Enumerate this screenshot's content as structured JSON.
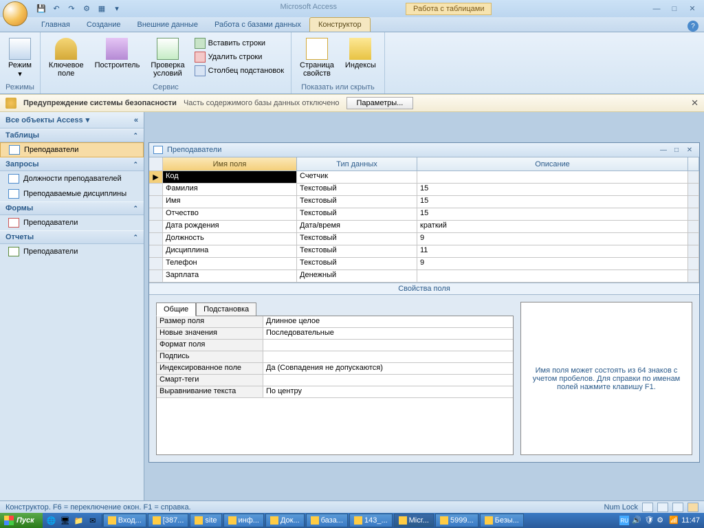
{
  "titlebar": {
    "app_name": "Microsoft Access",
    "contextual": "Работа с таблицами"
  },
  "tabs": {
    "items": [
      "Главная",
      "Создание",
      "Внешние данные",
      "Работа с базами данных",
      "Конструктор"
    ],
    "active": 4
  },
  "ribbon": {
    "groups": {
      "modes": {
        "label": "Режимы",
        "mode": "Режим"
      },
      "service": {
        "label": "Сервис",
        "key": "Ключевое\nполе",
        "builder": "Построитель",
        "test": "Проверка\nусловий",
        "insert_rows": "Вставить строки",
        "delete_rows": "Удалить строки",
        "lookup_col": "Столбец подстановок"
      },
      "show_hide": {
        "label": "Показать или скрыть",
        "prop_page": "Страница\nсвойств",
        "indexes": "Индексы"
      }
    }
  },
  "security": {
    "title": "Предупреждение системы безопасности",
    "text": "Часть содержимого базы данных отключено",
    "button": "Параметры..."
  },
  "nav": {
    "header": "Все объекты Access",
    "categories": [
      {
        "label": "Таблицы",
        "items": [
          "Преподаватели"
        ]
      },
      {
        "label": "Запросы",
        "items": [
          "Должности преподавателей",
          "Преподаваемые дисциплины"
        ]
      },
      {
        "label": "Формы",
        "items": [
          "Преподаватели"
        ]
      },
      {
        "label": "Отчеты",
        "items": [
          "Преподаватели"
        ]
      }
    ]
  },
  "doc": {
    "title": "Преподаватели",
    "columns": {
      "name": "Имя поля",
      "type": "Тип данных",
      "desc": "Описание"
    },
    "rows": [
      {
        "name": "Код",
        "type": "Счетчик",
        "desc": ""
      },
      {
        "name": "Фамилия",
        "type": "Текстовый",
        "desc": "15"
      },
      {
        "name": "Имя",
        "type": "Текстовый",
        "desc": "15"
      },
      {
        "name": "Отчество",
        "type": "Текстовый",
        "desc": "15"
      },
      {
        "name": "Дата рождения",
        "type": "Дата/время",
        "desc": "краткий"
      },
      {
        "name": "Должность",
        "type": "Текстовый",
        "desc": "9"
      },
      {
        "name": "Дисциплина",
        "type": "Текстовый",
        "desc": "11"
      },
      {
        "name": "Телефон",
        "type": "Текстовый",
        "desc": "9"
      },
      {
        "name": "Зарплата",
        "type": "Денежный",
        "desc": ""
      }
    ]
  },
  "field_props": {
    "title": "Свойства поля",
    "tabs": {
      "general": "Общие",
      "lookup": "Подстановка"
    },
    "rows": [
      {
        "label": "Размер поля",
        "val": "Длинное целое"
      },
      {
        "label": "Новые значения",
        "val": "Последовательные"
      },
      {
        "label": "Формат поля",
        "val": ""
      },
      {
        "label": "Подпись",
        "val": ""
      },
      {
        "label": "Индексированное поле",
        "val": "Да (Совпадения не допускаются)"
      },
      {
        "label": "Смарт-теги",
        "val": ""
      },
      {
        "label": "Выравнивание текста",
        "val": "По центру"
      }
    ],
    "help": "Имя поля может состоять из 64 знаков с учетом пробелов.  Для справки по именам полей нажмите клавишу F1."
  },
  "statusbar": {
    "left": "Конструктор.  F6 = переключение окон.  F1 = справка.",
    "numlock": "Num Lock"
  },
  "taskbar": {
    "start": "Пуск",
    "tasks": [
      "Вход...",
      "[387...",
      "site",
      "инф...",
      "Док...",
      "база...",
      "143_...",
      "Micr...",
      "5999...",
      "Безы..."
    ],
    "active_task": 7,
    "lang": "RU",
    "time": "11:47"
  }
}
